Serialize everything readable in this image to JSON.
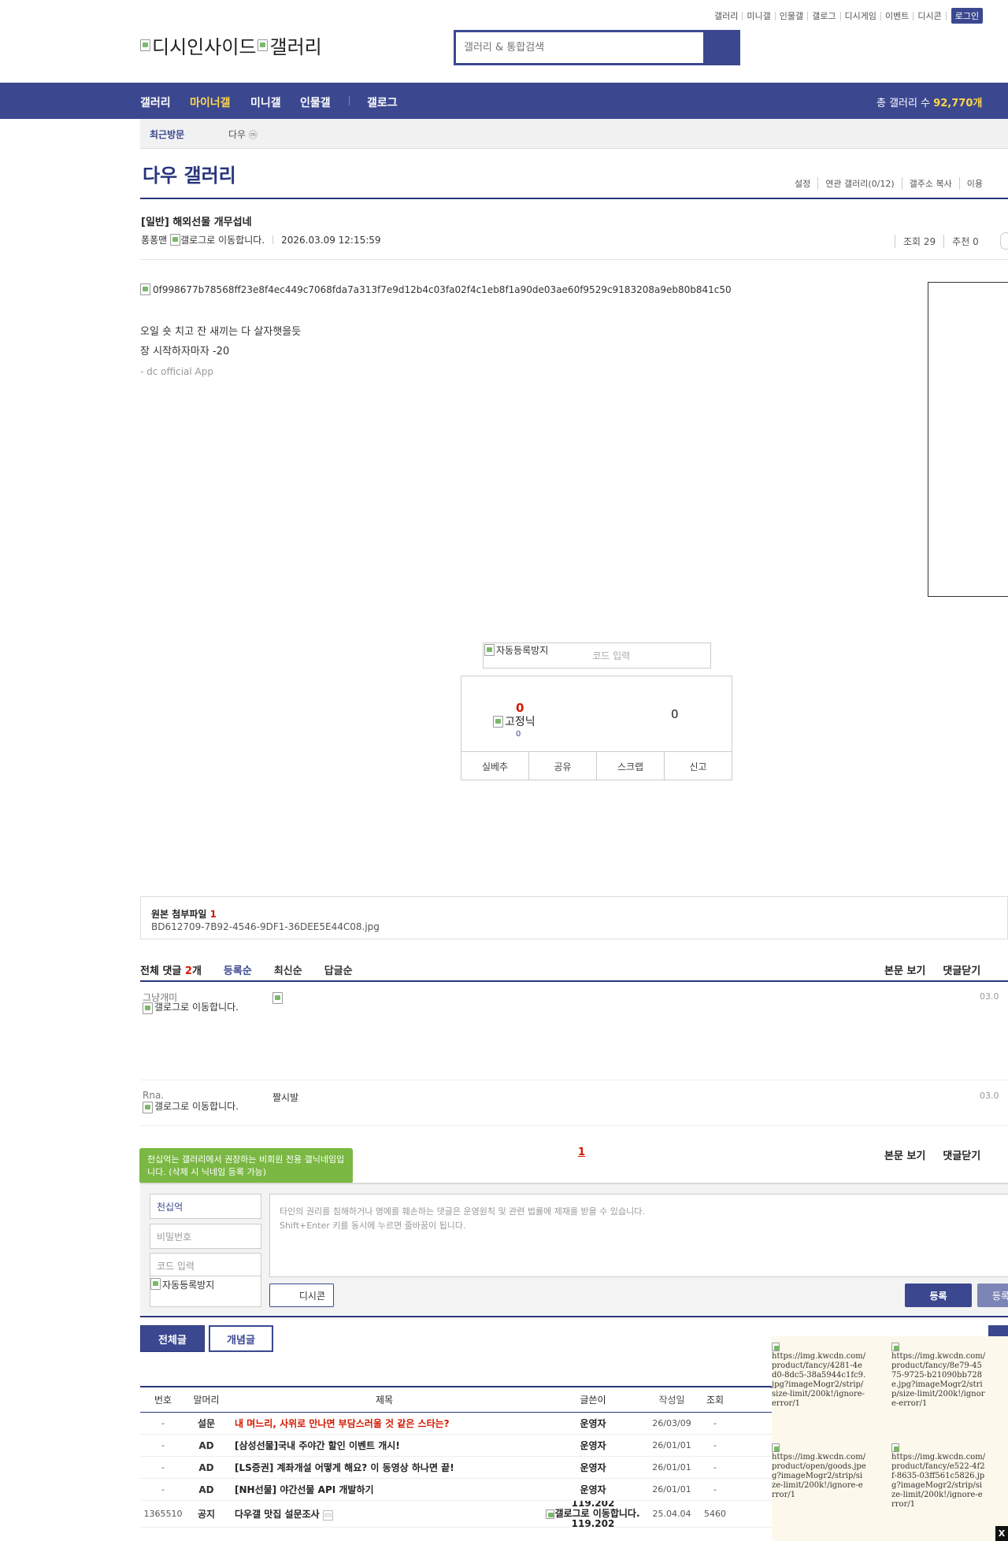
{
  "top_links": [
    "갤러리",
    "미니갤",
    "인물갤",
    "갤로그",
    "디시게임",
    "이벤트",
    "디시콘"
  ],
  "login_label": "로그인",
  "logo_alt": "디시인사이드",
  "logo_alt2": "갤러리",
  "search": {
    "placeholder": "갤러리 & 통합검색"
  },
  "gnb": {
    "items": [
      "갤러리",
      "마이너갤",
      "미니갤",
      "인물갤",
      "갤로그"
    ],
    "count_label": "총 갤러리 수",
    "count_value": "92,770개"
  },
  "recent": {
    "label": "최근방문",
    "item": "다우",
    "badge": "ⓜ"
  },
  "gallery": {
    "title": "다우 갤러리",
    "tools": [
      "설정",
      "연관 갤러리(0/12)",
      "갤주소 복사",
      "이용"
    ]
  },
  "post": {
    "title": "[일반] 해외선물 개무섭네",
    "writer": "퐁퐁맨",
    "gallog_alt": "갤로그로 이동합니다.",
    "date": "2026.03.09 12:15:59",
    "views": "조회 29",
    "recommend": "추천 0",
    "image_alt": "0f998677b78568ff23e8f4ec449c7068fda7a313f7e9d12b4c03fa02f4c1eb8f1a90de03ae60f9529c9183208a9eb80b841c50",
    "body_line1": "오일 숏 치고 잔 새끼는 다 살자햇을듯",
    "body_line2": "장 시작하자마자 -20",
    "signature": "- dc official App"
  },
  "vote": {
    "captcha_alt": "자동등록방지",
    "code_placeholder": "코드 입력",
    "up": "0",
    "fix_nick": "고정닉",
    "fix_count": "0",
    "down": "0",
    "buttons": [
      "실베추",
      "공유",
      "스크랩",
      "신고"
    ]
  },
  "attach": {
    "label": "원본 첨부파일",
    "count": "1",
    "file": "BD612709-7B92-4546-9DF1-36DEE5E44C08.jpg"
  },
  "comments": {
    "count_label": "전체 댓글",
    "count": "2",
    "count_unit": "개",
    "sorts": [
      "등록순",
      "최신순",
      "답글순"
    ],
    "tools": [
      "본문 보기",
      "댓글닫기"
    ],
    "items": [
      {
        "nick": "그냥개미",
        "gallog": "갤로그로 이동합니다.",
        "text": "",
        "date": "03.0"
      },
      {
        "nick": "Rna.",
        "gallog": "갤로그로 이동합니다.",
        "text": "짤시발",
        "date": "03.0"
      }
    ],
    "page": "1"
  },
  "write": {
    "tooltip": "천십억는 갤러리에서 권장하는 비회원 전용 갤닉네임입니다. (삭제 시 닉네임 등록 가능)",
    "nick": "천십억",
    "password": "비밀번호",
    "code": "코드 입력",
    "captcha_alt": "자동등록방지",
    "notice1": "타인의 권리를 침해하거나 명예를 훼손하는 댓글은 운영원칙 및 관련 법률에 제재를 받을 수 있습니다.",
    "notice2": "Shift+Enter 키를 동시에 누르면 줄바꿈이 됩니다.",
    "dccon": "디시콘",
    "submit": "등록",
    "submit2": "등록"
  },
  "list_tabs": {
    "all": "전체글",
    "concept": "개념글"
  },
  "list": {
    "headers": [
      "번호",
      "말머리",
      "제목",
      "글쓴이",
      "작성일",
      "조회"
    ],
    "rows": [
      {
        "no": "-",
        "head": "설문",
        "subject": "내 며느리, 사위로 만나면 부담스러울 것 같은 스타는?",
        "writer": "운영자",
        "date": "26/03/09",
        "views": "-",
        "red": true
      },
      {
        "no": "-",
        "head": "AD",
        "subject": "[삼성선물]국내 주야간 할인 이벤트 개시!",
        "writer": "운영자",
        "date": "26/01/01",
        "views": "-",
        "red": false
      },
      {
        "no": "-",
        "head": "AD",
        "subject": "[LS증권] 계좌개설 어떻게 해요? 이 동영상 하나면 끝!",
        "writer": "운영자",
        "date": "26/01/01",
        "views": "-",
        "red": false
      },
      {
        "no": "-",
        "head": "AD",
        "subject": "[NH선물] 야간선물 API 개발하기",
        "writer": "운영자",
        "date": "26/01/01",
        "views": "-",
        "red": false
      },
      {
        "no": "1365510",
        "head": "공지",
        "subject": "다우갤 맛집 설문조사",
        "writer": "119.202",
        "writer2": "갤로그로 이동합니다.",
        "writer3": "119.202",
        "date": "25.04.04",
        "views": "5460",
        "red": false
      }
    ]
  },
  "ads": [
    "https://img.kwcdn.com/product/fancy/4281-4ed0-8dc5-38a5944c1fc9.jpg?imageMogr2/strip/size-limit/200k!/ignore-error/1",
    "https://img.kwcdn.com/product/fancy/8e79-4575-9725-b21090bb728e.jpg?imageMogr2/strip/size-limit/200k!/ignore-error/1",
    "https://img.kwcdn.com/product/open/goods.jpeg?imageMogr2/strip/size-limit/200k!/ignore-error/1",
    "https://img.kwcdn.com/product/fancy/e522-4f2f-8635-03ff561c5826.jpg?imageMogr2/strip/size-limit/200k!/ignore-error/1"
  ],
  "close_label": "X",
  "colors": {
    "brand": "#3b4890",
    "accent": "#ffd64d",
    "red": "#d31900",
    "tooltip": "#7bb843"
  }
}
